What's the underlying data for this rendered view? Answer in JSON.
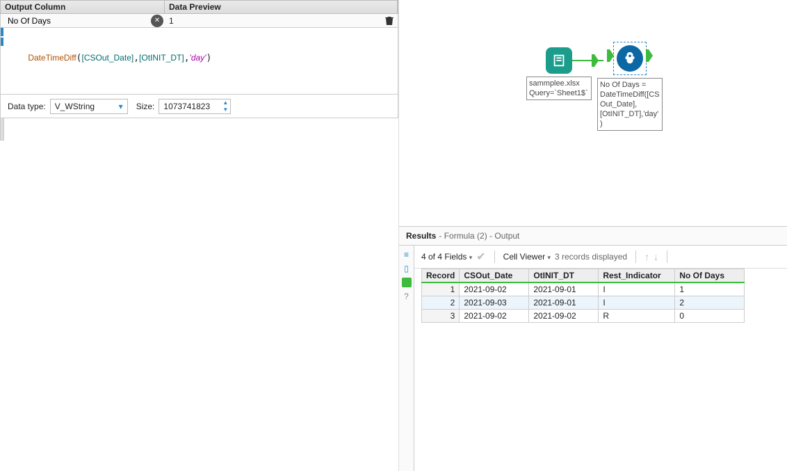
{
  "config": {
    "headers": {
      "output": "Output Column",
      "preview": "Data Preview"
    },
    "field_name": "No Of Days",
    "preview_value": "1",
    "formula": {
      "fn": "DateTimeDiff",
      "arg1": "[CSOut_Date]",
      "arg2": "[OtINIT_DT]",
      "arg3": "'day'"
    },
    "datatype": {
      "label": "Data type:",
      "value": "V_WString",
      "size_label": "Size:",
      "size": "1073741823"
    }
  },
  "canvas": {
    "input_tool": {
      "caption": "sammplee.xlsx\nQuery=`Sheet1$`"
    },
    "formula_tool": {
      "caption": "No Of Days = DateTimeDiff([CSOut_Date],[OtINIT_DT],'day')"
    }
  },
  "results": {
    "title": "Results",
    "subtitle": "- Formula (2) - Output",
    "fields_label": "4 of 4 Fields",
    "cell_viewer": "Cell Viewer",
    "records_label": "3 records displayed",
    "columns": [
      "Record",
      "CSOut_Date",
      "OtINIT_DT",
      "Rest_Indicator",
      "No Of Days"
    ],
    "rows": [
      {
        "n": "1",
        "csout": "2021-09-02",
        "otinit": "2021-09-01",
        "rest": "I",
        "days": "1"
      },
      {
        "n": "2",
        "csout": "2021-09-03",
        "otinit": "2021-09-01",
        "rest": "I",
        "days": "2"
      },
      {
        "n": "3",
        "csout": "2021-09-02",
        "otinit": "2021-09-02",
        "rest": "R",
        "days": "0"
      }
    ]
  }
}
